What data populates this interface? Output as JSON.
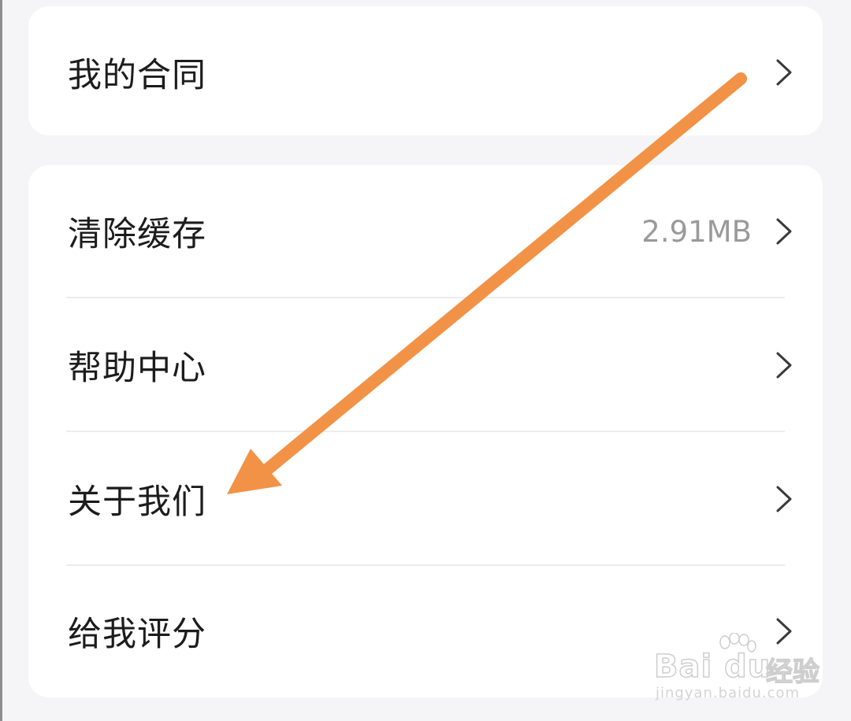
{
  "contract_card": {
    "items": [
      {
        "label": "我的合同",
        "value": ""
      }
    ]
  },
  "settings_card": {
    "items": [
      {
        "label": "清除缓存",
        "value": "2.91MB"
      },
      {
        "label": "帮助中心",
        "value": ""
      },
      {
        "label": "关于我们",
        "value": ""
      },
      {
        "label": "给我评分",
        "value": ""
      }
    ]
  },
  "annotation": {
    "arrow_color": "#f29247",
    "target": "关于我们"
  },
  "watermark": {
    "brand": "Bai du",
    "brand_cn": "经验",
    "url": "jingyan.baidu.com"
  },
  "icons": {
    "row_chevron": "chevron-right-icon"
  }
}
